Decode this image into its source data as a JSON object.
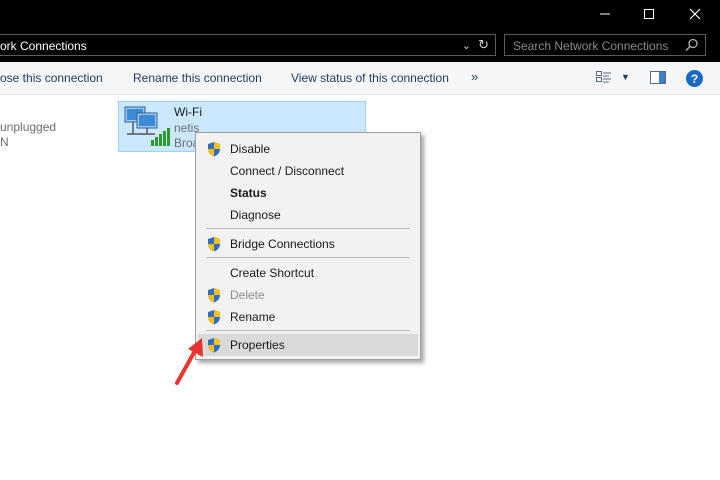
{
  "window": {
    "minimize_icon": "minimize-icon",
    "maximize_icon": "maximize-icon",
    "close_icon": "close-icon"
  },
  "address": {
    "path": "ork Connections"
  },
  "search": {
    "placeholder": "Search Network Connections"
  },
  "commands": {
    "close_connection": "ose this connection",
    "rename": "Rename this connection",
    "view_status": "View status of this connection",
    "more": "»"
  },
  "left_item": {
    "line1": "unplugged",
    "line2": "N"
  },
  "wifi": {
    "name": "Wi-Fi",
    "network": "netis",
    "device": "Broa"
  },
  "menu": {
    "items": [
      {
        "label": "Disable",
        "shield": true
      },
      {
        "label": "Connect / Disconnect",
        "shield": false
      },
      {
        "label": "Status",
        "shield": false,
        "bold": true
      },
      {
        "label": "Diagnose",
        "shield": false
      },
      {
        "label": "Bridge Connections",
        "shield": true
      },
      {
        "label": "Create Shortcut",
        "shield": false
      },
      {
        "label": "Delete",
        "shield": true,
        "disabled": true
      },
      {
        "label": "Rename",
        "shield": true
      },
      {
        "label": "Properties",
        "shield": true,
        "highlighted": true
      }
    ]
  },
  "colors": {
    "titlebar": "#000000",
    "command_text": "#1e395b",
    "selection": "#cce8ff",
    "menu_bg": "#f2f2f2",
    "arrow": "#e8352e"
  }
}
